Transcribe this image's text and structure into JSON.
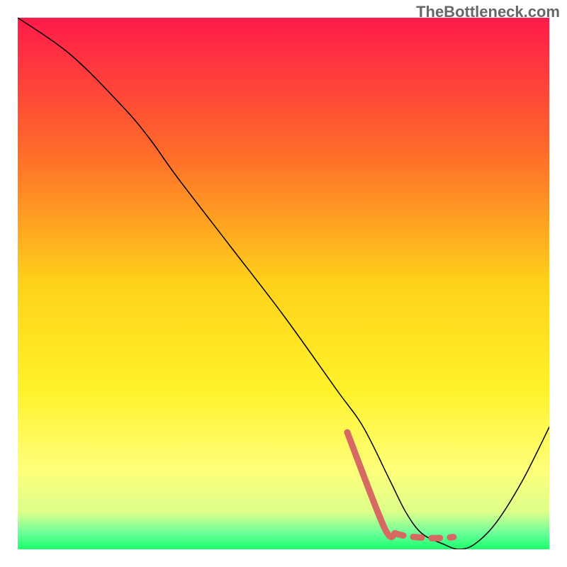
{
  "watermark": "TheBottleneck.com",
  "chart_data": {
    "type": "line",
    "title": "",
    "xlabel": "",
    "ylabel": "",
    "xlim": [
      0,
      100
    ],
    "ylim": [
      0,
      100
    ],
    "grid": false,
    "legend": false,
    "background_gradient": {
      "stops": [
        {
          "offset": 0,
          "color": "#ff1a4a"
        },
        {
          "offset": 25,
          "color": "#ff6a2a"
        },
        {
          "offset": 50,
          "color": "#ffd21a"
        },
        {
          "offset": 70,
          "color": "#fff22a"
        },
        {
          "offset": 85,
          "color": "#ffff7a"
        },
        {
          "offset": 93,
          "color": "#ddff8a"
        },
        {
          "offset": 97,
          "color": "#6aff9a"
        },
        {
          "offset": 100,
          "color": "#1aff6a"
        }
      ]
    },
    "series": [
      {
        "name": "bottleneck-curve",
        "color": "#000000",
        "width": 1.5,
        "x": [
          0,
          10,
          20,
          25,
          30,
          40,
          50,
          60,
          65,
          70,
          73,
          76,
          80,
          83,
          86,
          90,
          95,
          100
        ],
        "y": [
          100,
          93,
          83,
          77,
          70,
          57,
          44,
          30,
          23,
          13,
          7,
          3,
          1,
          0,
          1,
          5,
          13,
          23
        ]
      },
      {
        "name": "highlight-pink",
        "color": "#d66a63",
        "width": 9,
        "style": "solid-then-dashed",
        "x": [
          62,
          69,
          71,
          73,
          76,
          79,
          82
        ],
        "y": [
          22,
          4,
          3,
          2.5,
          2.2,
          2.1,
          2.3
        ],
        "dash_segments": [
          {
            "from": 0,
            "to": 2,
            "dash": "none"
          },
          {
            "from": 2,
            "to": 6,
            "dash": "6 8"
          }
        ]
      }
    ]
  }
}
